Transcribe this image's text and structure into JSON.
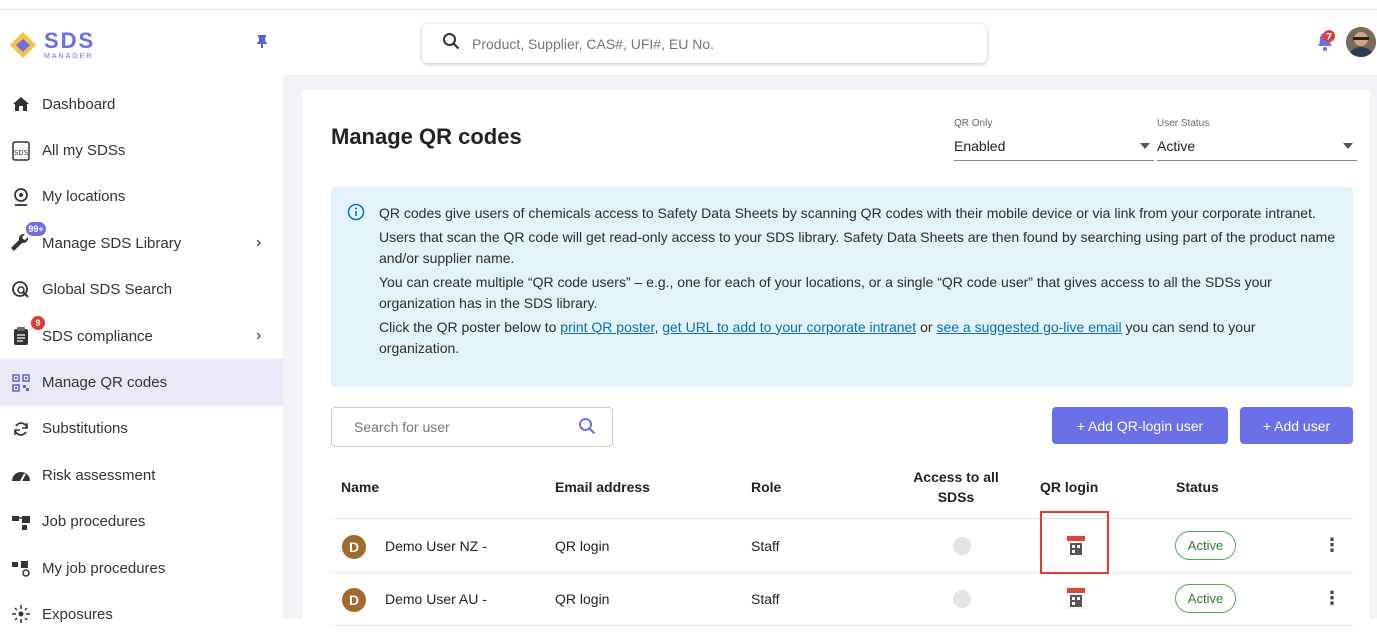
{
  "brand": {
    "name": "SDS",
    "sub": "MANAGER",
    "accent": "#6b6fe8"
  },
  "search": {
    "placeholder": "Product, Supplier, CAS#, UFI#, EU No."
  },
  "notifications": {
    "count": "7"
  },
  "sidebar": {
    "items": [
      {
        "label": "Dashboard",
        "icon": "home-icon"
      },
      {
        "label": "All my SDSs",
        "icon": "sds-file-icon"
      },
      {
        "label": "My locations",
        "icon": "location-pin-icon"
      },
      {
        "label": "Manage SDS Library",
        "icon": "wrench-icon",
        "badge": "99+"
      },
      {
        "label": "Global SDS Search",
        "icon": "global-search-icon"
      },
      {
        "label": "SDS compliance",
        "icon": "clipboard-icon",
        "badge": "9"
      },
      {
        "label": "Manage QR codes",
        "icon": "qr-code-icon",
        "active": true
      },
      {
        "label": "Substitutions",
        "icon": "swap-icon"
      },
      {
        "label": "Risk assessment",
        "icon": "gauge-icon"
      },
      {
        "label": "Job procedures",
        "icon": "job-procedures-icon"
      },
      {
        "label": "My job procedures",
        "icon": "my-job-procedures-icon"
      },
      {
        "label": "Exposures",
        "icon": "exposures-icon"
      }
    ]
  },
  "page": {
    "title": "Manage QR codes",
    "filters": {
      "qr_only": {
        "label": "QR Only",
        "value": "Enabled"
      },
      "user_status": {
        "label": "User Status",
        "value": "Active"
      }
    },
    "info": {
      "p1": "QR codes give users of chemicals access to Safety Data Sheets by scanning QR codes with their mobile device or via link from your corporate intranet.",
      "p2": "Users that scan the QR code will get read-only access to your SDS library. Safety Data Sheets are then found by searching using part of the product name and/or supplier name.",
      "p3": "You can create multiple “QR code users” – e.g., one for each of your locations, or a single “QR code user” that gives access to all the SDSs your organization has in the SDS library.",
      "p4_a": "Click the QR poster below to ",
      "link1": "print QR poster",
      "p4_b": ", ",
      "link2": "get URL to add to your corporate intranet",
      "p4_c": " or ",
      "link3": "see a suggested go-live email",
      "p4_d": " you can send to your organization."
    },
    "user_search": {
      "placeholder": "Search for user"
    },
    "buttons": {
      "add_qr_login": "+  Add QR-login user",
      "add_user": "+  Add user"
    },
    "table": {
      "headers": {
        "name": "Name",
        "email": "Email address",
        "role": "Role",
        "access_1": "Access to all",
        "access_2": "SDSs",
        "qr_login": "QR login",
        "status": "Status"
      },
      "rows": [
        {
          "initial": "D",
          "name": "Demo User NZ -",
          "email": "QR login",
          "role": "Staff",
          "status": "Active"
        },
        {
          "initial": "D",
          "name": "Demo User AU -",
          "email": "QR login",
          "role": "Staff",
          "status": "Active"
        }
      ]
    }
  }
}
